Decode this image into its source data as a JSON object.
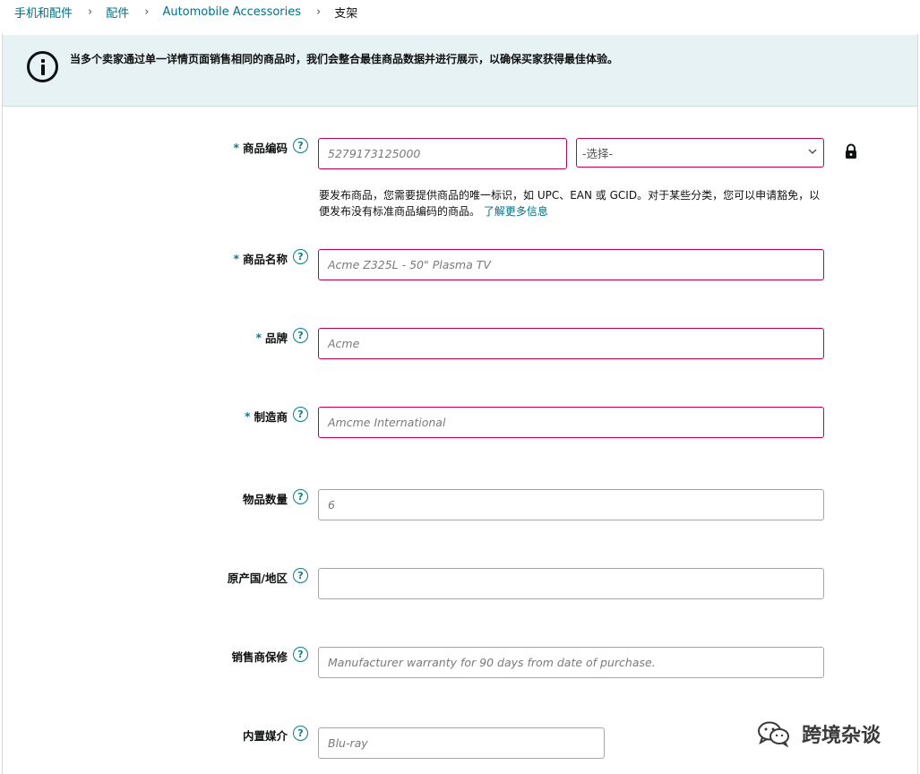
{
  "breadcrumb": {
    "items": [
      "手机和配件",
      "配件",
      "Automobile Accessories",
      "支架"
    ],
    "separator": "›"
  },
  "alert": {
    "message": "当多个卖家通过单一详情页面销售相同的商品时，我们会整合最佳商品数据并进行展示，以确保买家获得最佳体验。",
    "icon": "info-icon"
  },
  "form": {
    "required_mark": "*",
    "help_glyph": "?",
    "product_id": {
      "label": "商品编码",
      "value": "5279173125000",
      "type_placeholder": "-选择-",
      "hint": "要发布商品，您需要提供商品的唯一标识，如 UPC、EAN 或 GCID。对于某些分类，您可以申请豁免，以便发布没有标准商品编码的商品。",
      "hint_link": "了解更多信息"
    },
    "item_name": {
      "label": "商品名称",
      "value": "Acme Z325L - 50\" Plasma TV"
    },
    "brand": {
      "label": "品牌",
      "value": "Acme"
    },
    "manufacturer": {
      "label": "制造商",
      "value": "Amcme International"
    },
    "item_quantity": {
      "label": "物品数量",
      "value": "6"
    },
    "country_of_origin": {
      "label": "原产国/地区",
      "value": ""
    },
    "seller_warranty": {
      "label": "销售商保修",
      "value": "Manufacturer warranty for 90 days from date of purchase."
    },
    "included_media": {
      "label": "内置媒介",
      "value": "Blu-ray"
    }
  },
  "watermark": {
    "text": "跨境杂谈"
  },
  "colors": {
    "link": "#007185",
    "error_border": "#c40050",
    "alert_bg": "#e7f2f4",
    "help": "#0a7b87"
  }
}
